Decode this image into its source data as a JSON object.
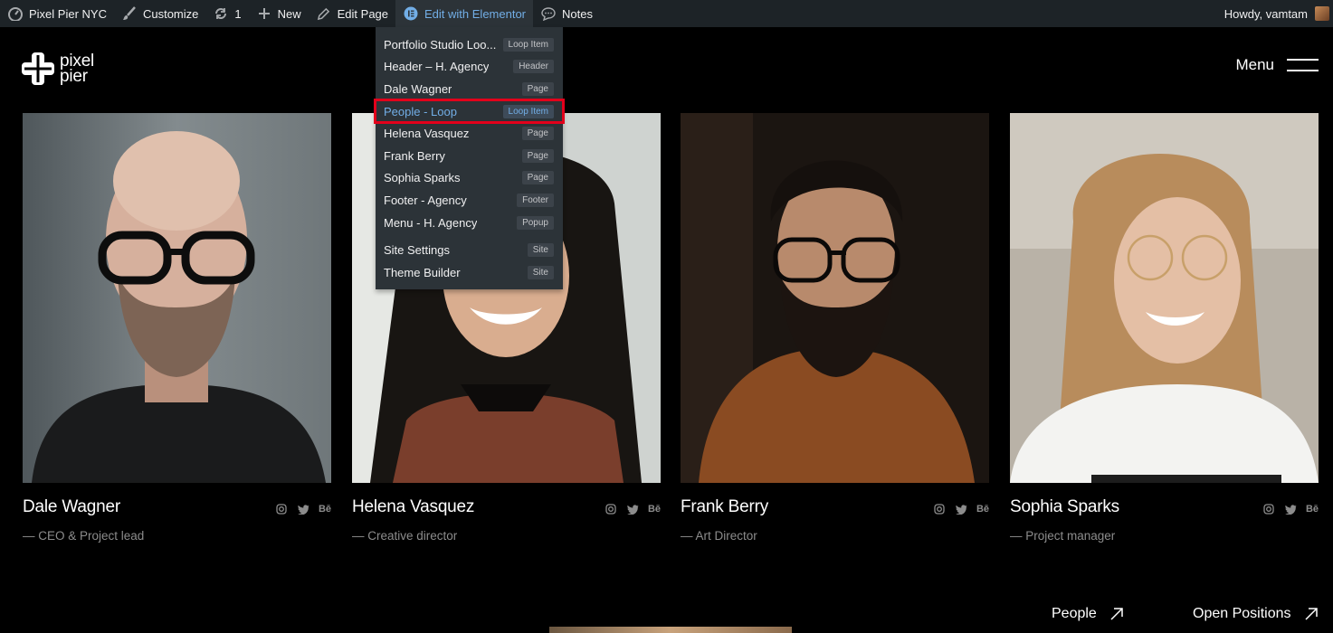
{
  "adminbar": {
    "site_name": "Pixel Pier NYC",
    "customize": "Customize",
    "updates_count": "1",
    "new_label": "New",
    "edit_page": "Edit Page",
    "edit_elementor": "Edit with Elementor",
    "notes": "Notes",
    "howdy": "Howdy, vamtam"
  },
  "elementor_menu": {
    "items": [
      {
        "label": "Portfolio Studio Loo...",
        "badge": "Loop Item"
      },
      {
        "label": "Header – H. Agency",
        "badge": "Header"
      },
      {
        "label": "Dale Wagner",
        "badge": "Page"
      },
      {
        "label": "People - Loop",
        "badge": "Loop Item"
      },
      {
        "label": "Helena Vasquez",
        "badge": "Page"
      },
      {
        "label": "Frank Berry",
        "badge": "Page"
      },
      {
        "label": "Sophia Sparks",
        "badge": "Page"
      },
      {
        "label": "Footer - Agency",
        "badge": "Footer"
      },
      {
        "label": "Menu - H. Agency",
        "badge": "Popup"
      },
      {
        "label": "Site Settings",
        "badge": "Site"
      },
      {
        "label": "Theme Builder",
        "badge": "Site"
      }
    ]
  },
  "header": {
    "logo_line1": "pixel",
    "logo_line2": "pier",
    "menu_label": "Menu"
  },
  "people": [
    {
      "name": "Dale Wagner",
      "role": "— CEO & Project lead"
    },
    {
      "name": "Helena Vasquez",
      "role": "— Creative director"
    },
    {
      "name": "Frank Berry",
      "role": "— Art Director"
    },
    {
      "name": "Sophia Sparks",
      "role": "— Project manager"
    }
  ],
  "social_behance": "Bē",
  "footer_links": {
    "people": "People",
    "open_positions": "Open Positions"
  },
  "colors": {
    "adminbar_bg": "#1d2327",
    "dropdown_bg": "#2c3338",
    "accent": "#72aee6",
    "highlight_outline": "#e3001b"
  }
}
